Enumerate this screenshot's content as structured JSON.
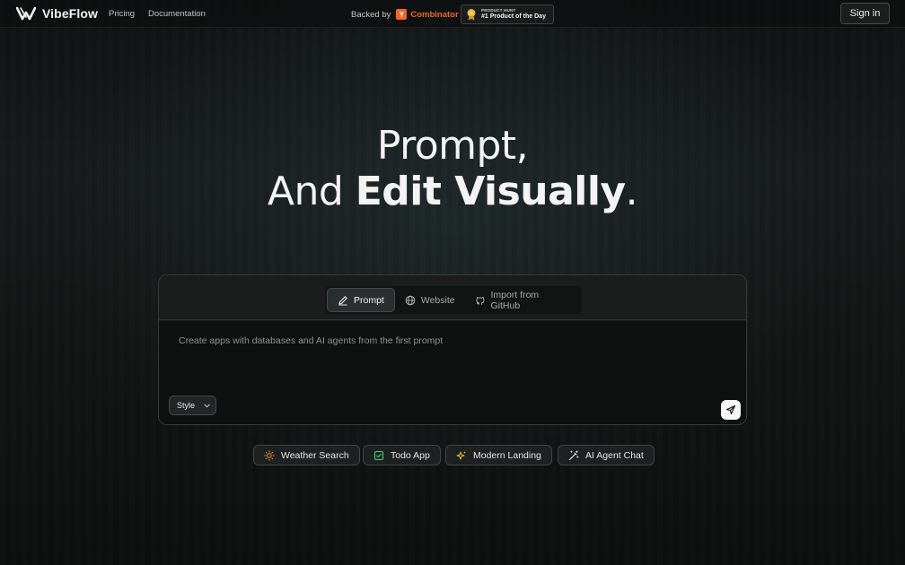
{
  "nav": {
    "brand": "VibeFlow",
    "links": [
      "Pricing",
      "Documentation"
    ],
    "backed_by": "Backed by",
    "yc_letter": "Y",
    "yc_name": "Combinator",
    "product_hunt_small": "PRODUCT HUNT",
    "product_hunt_big": "#1 Product of the Day",
    "signin": "Sign in"
  },
  "hero": {
    "line1": "Prompt,",
    "line2_prefix": "And ",
    "line2_bold": "Edit Visually",
    "line2_suffix": "."
  },
  "composer": {
    "tabs": [
      {
        "label": "Prompt",
        "icon": "pencil-icon",
        "active": true
      },
      {
        "label": "Website",
        "icon": "globe-icon",
        "active": false
      },
      {
        "label": "Import from GitHub",
        "icon": "github-icon",
        "active": false
      }
    ],
    "placeholder": "Create apps with databases and AI agents from the first prompt",
    "value": "",
    "style_label": "Style",
    "send_icon": "send-icon"
  },
  "suggestions": [
    {
      "label": "Weather Search",
      "icon": "sun-icon",
      "color": "#f08a3c"
    },
    {
      "label": "Todo App",
      "icon": "checkbox-icon",
      "color": "#3ccf6e"
    },
    {
      "label": "Modern Landing",
      "icon": "sparkles-icon",
      "color": "#e6b93a"
    },
    {
      "label": "AI Agent Chat",
      "icon": "magic-wand-icon",
      "color": "#d9d9d9"
    }
  ]
}
